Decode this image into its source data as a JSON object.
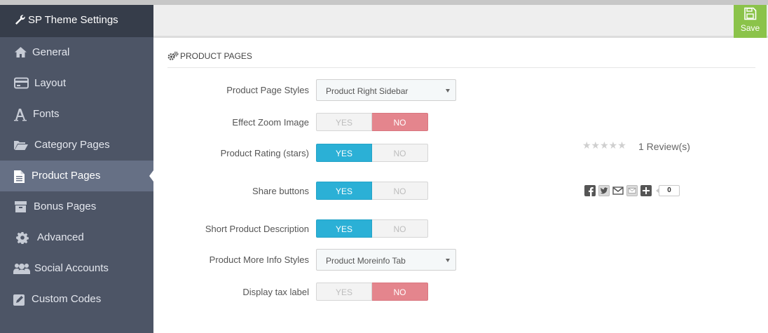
{
  "sidebar": {
    "header": "SP Theme Settings",
    "items": [
      {
        "label": "General",
        "icon": "home-icon"
      },
      {
        "label": "Layout",
        "icon": "credit-card-icon"
      },
      {
        "label": "Fonts",
        "icon": "font-icon"
      },
      {
        "label": "Category Pages",
        "icon": "folder-open-icon"
      },
      {
        "label": "Product Pages",
        "icon": "file-icon",
        "active": true
      },
      {
        "label": "Bonus Pages",
        "icon": "archive-icon"
      },
      {
        "label": "Advanced",
        "icon": "gear-icon"
      },
      {
        "label": "Social Accounts",
        "icon": "users-icon"
      },
      {
        "label": "Custom Codes",
        "icon": "edit-icon"
      }
    ]
  },
  "toolbar": {
    "save_label": "Save",
    "accent": "#8bc34a"
  },
  "section": {
    "title": "PRODUCT PAGES",
    "icon": "cogs-icon"
  },
  "fields": {
    "page_styles": {
      "label": "Product Page Styles",
      "value": "Product Right Sidebar"
    },
    "zoom": {
      "label": "Effect Zoom Image",
      "yes": "YES",
      "no": "NO",
      "selected": "NO"
    },
    "rating": {
      "label": "Product Rating (stars)",
      "yes": "YES",
      "no": "NO",
      "selected": "YES"
    },
    "share": {
      "label": "Share buttons",
      "yes": "YES",
      "no": "NO",
      "selected": "YES"
    },
    "short_desc": {
      "label": "Short Product Description",
      "yes": "YES",
      "no": "NO",
      "selected": "YES"
    },
    "more_info": {
      "label": "Product More Info Styles",
      "value": "Product Moreinfo Tab"
    },
    "tax": {
      "label": "Display tax label",
      "yes": "YES",
      "no": "NO",
      "selected": "NO"
    }
  },
  "preview": {
    "stars": "★★★★★",
    "star_rating": 0,
    "reviews": "1 Review(s)",
    "share_count": "0",
    "share_icons": [
      "facebook-icon",
      "twitter-icon",
      "gmail-icon",
      "email-icon",
      "plus-icon"
    ]
  },
  "colors": {
    "yes_on": "#2bb0d6",
    "no_on": "#e4858d",
    "sidebar": "#4d5566",
    "sidebar_header": "#363d4a"
  }
}
